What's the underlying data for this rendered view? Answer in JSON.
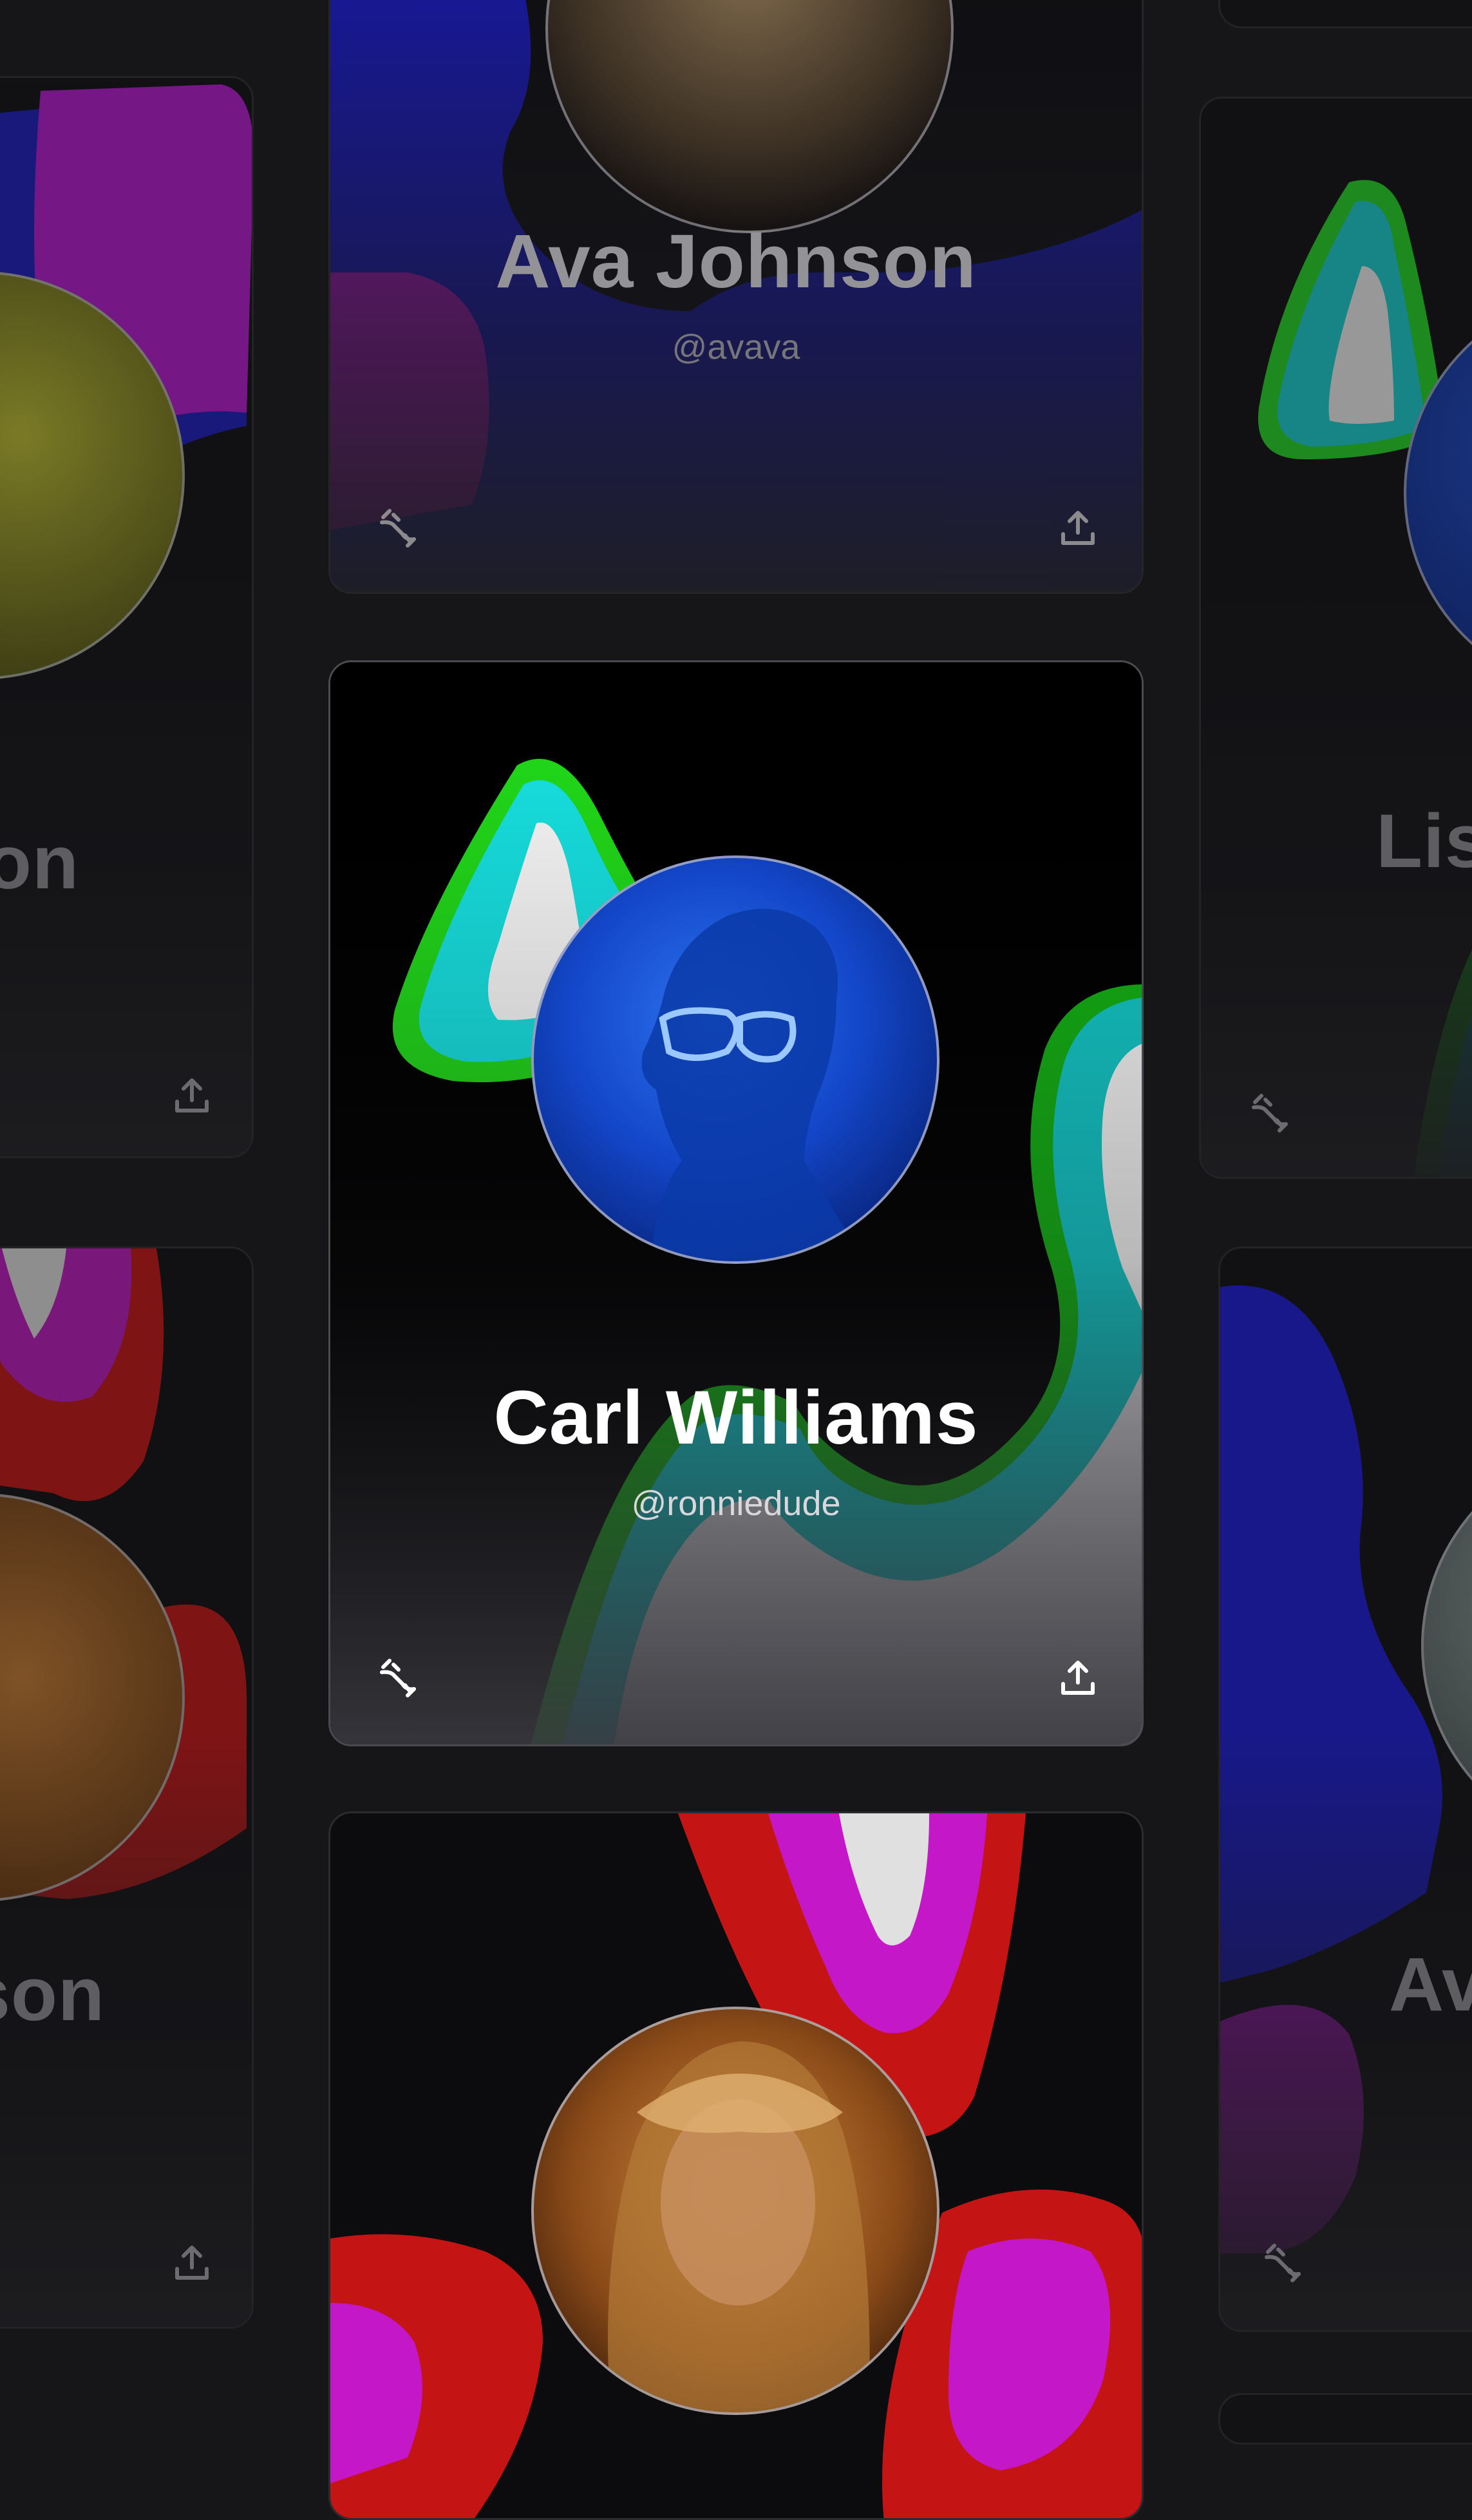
{
  "gallery": {
    "cards": [
      {
        "id": "ava-top",
        "name": "Ava Johnson",
        "handle": "@avava"
      },
      {
        "id": "left-top",
        "name_fragment": "on"
      },
      {
        "id": "right-top",
        "name_fragment": "Lis"
      },
      {
        "id": "carl",
        "name": "Carl Williams",
        "handle": "@ronniedude"
      },
      {
        "id": "left-bottom",
        "name_fragment": "oson"
      },
      {
        "id": "right-bottom",
        "name_fragment": "Av"
      },
      {
        "id": "bottom",
        "name": "",
        "handle": ""
      }
    ]
  },
  "icons": {
    "unlink": "unlink-icon",
    "share": "share-upload-icon"
  },
  "colors": {
    "page_background": "#161618",
    "card_border": "#2c2c30",
    "neon_green": "#22e01a",
    "neon_cyan": "#18e8e8",
    "blue": "#1a2ad8",
    "magenta": "#c41ad0",
    "red": "#c21414"
  }
}
